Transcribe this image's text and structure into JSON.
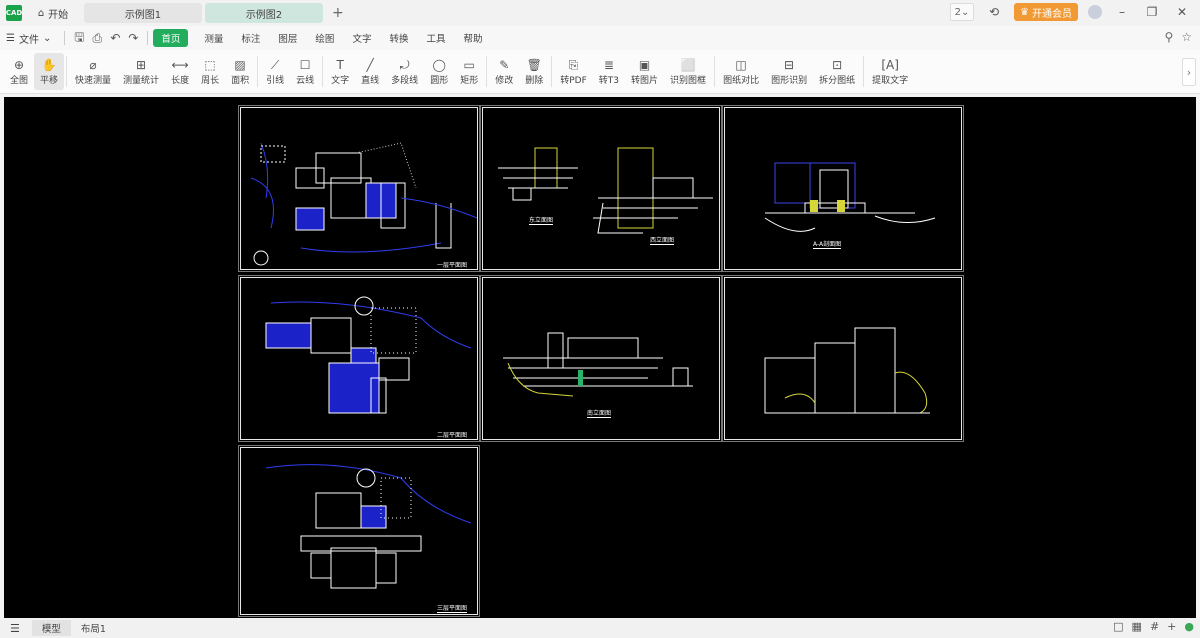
{
  "titlebar": {
    "logo": "CAD",
    "home_icon": "home-icon",
    "home_label": "开始",
    "tabs": [
      {
        "label": "示例图1",
        "active": false
      },
      {
        "label": "示例图2",
        "active": true
      }
    ],
    "new_tab_label": "+",
    "zoom_select": "2",
    "vip_label": "开通会员",
    "window_controls": [
      "minimize-icon",
      "restore-icon",
      "close-icon"
    ]
  },
  "menubar": {
    "file_label": "文件",
    "quick_icons": [
      "save-icon",
      "print-icon",
      "undo-icon",
      "redo-icon"
    ],
    "tabs": [
      {
        "label": "首页",
        "active": true
      },
      {
        "label": "测量"
      },
      {
        "label": "标注"
      },
      {
        "label": "图层"
      },
      {
        "label": "绘图"
      },
      {
        "label": "文字"
      },
      {
        "label": "转换"
      },
      {
        "label": "工具"
      },
      {
        "label": "帮助"
      }
    ],
    "right_icons": [
      "search-icon",
      "star-icon"
    ]
  },
  "toolbar": {
    "tools": [
      {
        "label": "全图",
        "dropdown": true
      },
      {
        "label": "平移",
        "active": true
      },
      {
        "label": "快速测量"
      },
      {
        "label": "测量统计"
      },
      {
        "label": "长度"
      },
      {
        "label": "周长"
      },
      {
        "label": "面积",
        "dropdown": true
      },
      {
        "label": "引线"
      },
      {
        "label": "云线",
        "dropdown": true
      },
      {
        "label": "文字",
        "dropdown": true
      },
      {
        "label": "直线",
        "dropdown": true
      },
      {
        "label": "多段线"
      },
      {
        "label": "圆形",
        "dropdown": true
      },
      {
        "label": "矩形",
        "dropdown": true
      },
      {
        "label": "修改",
        "dropdown": true
      },
      {
        "label": "删除",
        "dropdown": true
      },
      {
        "label": "转PDF",
        "dropdown": true
      },
      {
        "label": "转T3"
      },
      {
        "label": "转图片",
        "dropdown": true
      },
      {
        "label": "识别图框",
        "dropdown": true
      },
      {
        "label": "图纸对比"
      },
      {
        "label": "图形识别"
      },
      {
        "label": "拆分图纸",
        "dropdown": true
      },
      {
        "label": "提取文字",
        "dropdown": true
      }
    ]
  },
  "drawings": [
    {
      "title": "一层平面图"
    },
    {
      "title": "东立面图"
    },
    {
      "title": "西立面图"
    },
    {
      "title": "A-A剖面图"
    },
    {
      "title": "二层平面图"
    },
    {
      "title": "南立面图"
    },
    {
      "title": "三层平面图"
    }
  ],
  "statusbar": {
    "menu_icon": "menu-icon",
    "tabs": [
      {
        "label": "模型",
        "active": true
      },
      {
        "label": "布局1"
      }
    ],
    "right_icons": [
      "viewport-icon",
      "grid-icon",
      "snap-icon",
      "crosshair-icon",
      "color-icon"
    ]
  }
}
